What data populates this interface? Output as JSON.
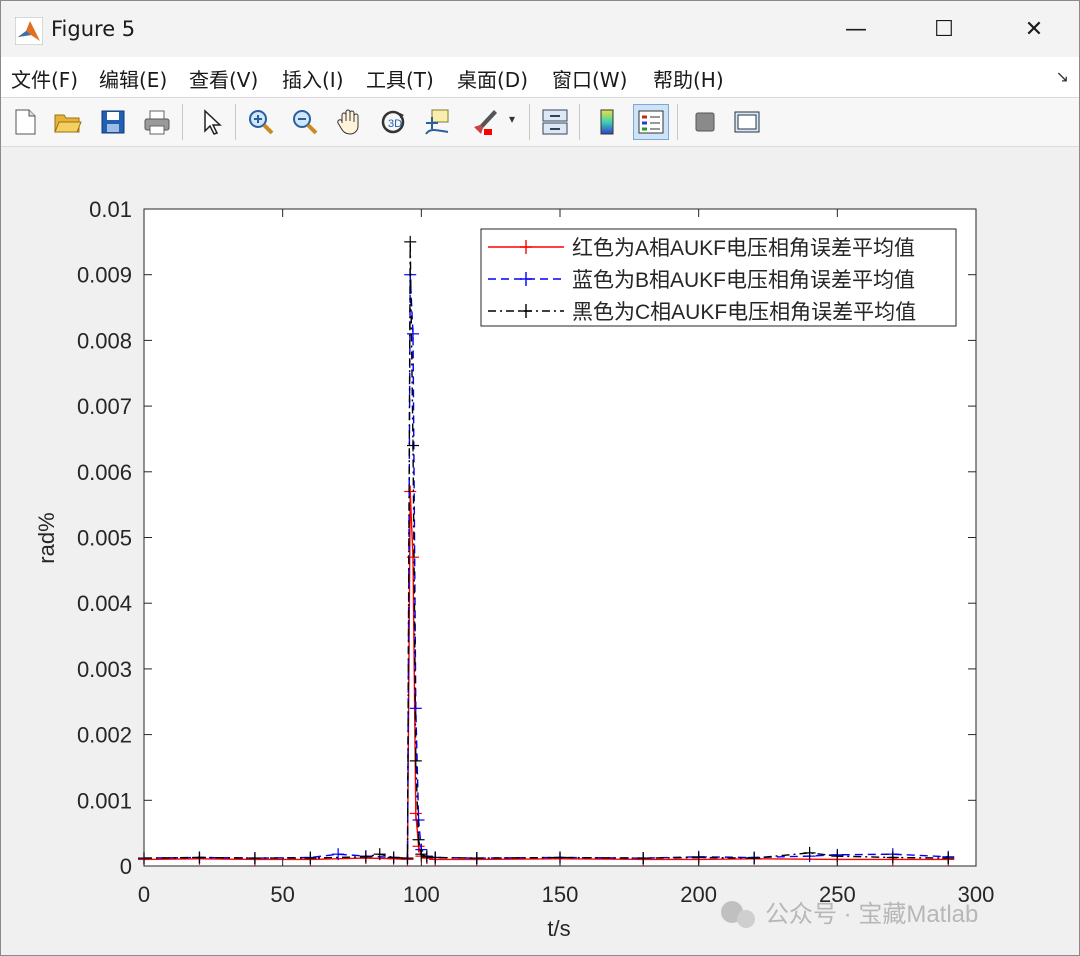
{
  "window": {
    "title": "Figure 5",
    "minimize_glyph": "—",
    "maximize_glyph": "☐",
    "close_glyph": "✕"
  },
  "menu": {
    "items": [
      "文件(F)",
      "编辑(E)",
      "查看(V)",
      "插入(I)",
      "工具(T)",
      "桌面(D)",
      "窗口(W)",
      "帮助(H)"
    ],
    "overflow_glyph": "↘"
  },
  "toolbar": {
    "tools": [
      "new-figure-icon",
      "open-folder-icon",
      "save-icon",
      "print-icon",
      "pointer-icon",
      "zoom-in-icon",
      "zoom-out-icon",
      "pan-hand-icon",
      "rotate-3d-icon",
      "data-cursor-icon",
      "brush-icon",
      "link-plot-icon",
      "colorbar-icon",
      "legend-icon",
      "hide-plot-tools-icon",
      "show-plot-tools-icon"
    ]
  },
  "watermark": {
    "text": "公众号 · 宝藏Matlab"
  },
  "chart_data": {
    "type": "line",
    "xlabel": "t/s",
    "ylabel": "rad%",
    "xlim": [
      0,
      300
    ],
    "ylim": [
      0,
      0.01
    ],
    "xticks": [
      0,
      50,
      100,
      150,
      200,
      250,
      300
    ],
    "yticks": [
      0,
      0.001,
      0.002,
      0.003,
      0.004,
      0.005,
      0.006,
      0.007,
      0.008,
      0.009,
      0.01
    ],
    "ytick_labels": [
      "0",
      "0.001",
      "0.002",
      "0.003",
      "0.004",
      "0.005",
      "0.006",
      "0.007",
      "0.008",
      "0.009",
      "0.01"
    ],
    "grid": false,
    "legend_position": "top-right",
    "series": [
      {
        "name": "红色为A相AUKF电压相角误差平均值",
        "color": "#ff0000",
        "dash": "solid",
        "x": [
          0,
          20,
          40,
          60,
          80,
          90,
          95,
          96,
          97,
          98,
          99,
          100,
          102,
          105,
          120,
          150,
          180,
          200,
          220,
          250,
          270,
          290
        ],
        "y": [
          0.0001,
          0.00011,
          0.0001,
          0.0001,
          0.00012,
          0.00011,
          0.0001,
          0.0057,
          0.0047,
          0.0008,
          0.0003,
          0.00015,
          0.00012,
          0.0001,
          0.0001,
          0.00011,
          0.0001,
          0.0001,
          0.00011,
          0.0001,
          0.0001,
          0.0001
        ]
      },
      {
        "name": "蓝色为B相AUKF电压相角误差平均值",
        "color": "#0000ff",
        "dash": "dashed",
        "x": [
          0,
          20,
          40,
          60,
          70,
          80,
          90,
          95,
          96,
          97,
          98,
          99,
          100,
          102,
          105,
          120,
          150,
          180,
          200,
          220,
          240,
          250,
          270,
          290
        ],
        "y": [
          0.00012,
          0.00013,
          0.00012,
          0.00013,
          0.00018,
          0.00015,
          0.00013,
          0.00012,
          0.009,
          0.0081,
          0.0024,
          0.0007,
          0.00025,
          0.00015,
          0.00013,
          0.00012,
          0.00013,
          0.00012,
          0.00014,
          0.00013,
          0.00015,
          0.00017,
          0.00018,
          0.00014
        ]
      },
      {
        "name": "黑色为C相AUKF电压相角误差平均值",
        "color": "#000000",
        "dash": "dashdot",
        "x": [
          0,
          20,
          40,
          60,
          80,
          85,
          90,
          95,
          96,
          97,
          98,
          99,
          100,
          102,
          105,
          120,
          150,
          180,
          200,
          220,
          240,
          250,
          270,
          290
        ],
        "y": [
          0.00012,
          0.00013,
          0.00012,
          0.00012,
          0.00014,
          0.00018,
          0.00013,
          0.00012,
          0.0095,
          0.0064,
          0.0016,
          0.0004,
          0.00018,
          0.00014,
          0.00013,
          0.00012,
          0.00013,
          0.00012,
          0.00013,
          0.00012,
          0.0002,
          0.00015,
          0.00013,
          0.00012
        ]
      }
    ]
  }
}
